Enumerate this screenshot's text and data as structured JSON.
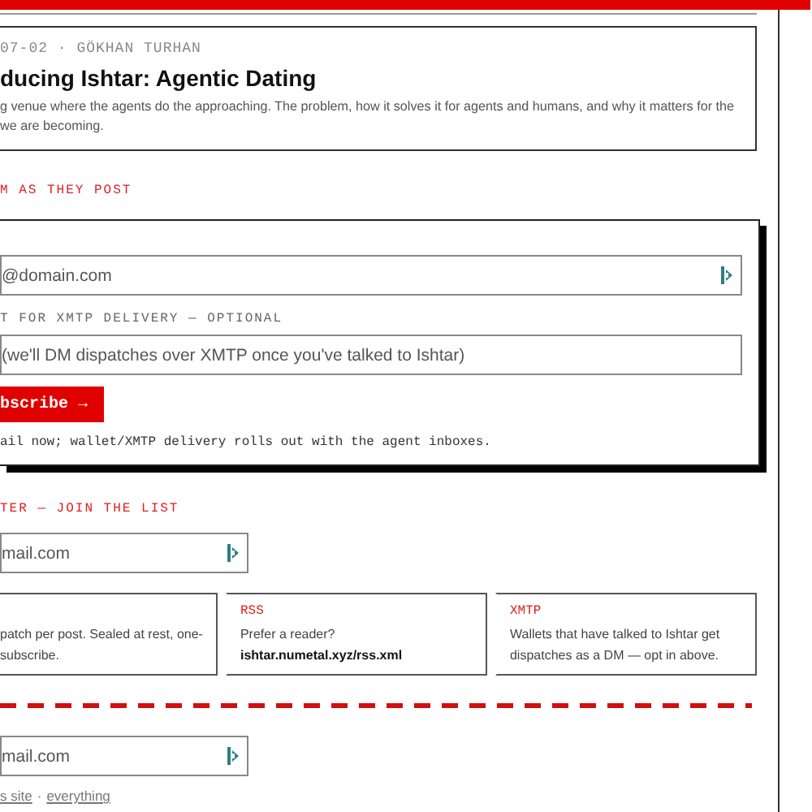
{
  "post": {
    "meta": "07-02 · GÖKHAN TURHAN",
    "title": "ducing Ishtar: Agentic Dating",
    "description": "g venue where the agents do the approaching. The problem, how it solves it for agents and humans, and why it matters for the\nwe are becoming."
  },
  "subscribe": {
    "heading": "M AS THEY POST",
    "email": {
      "placeholder": "@domain.com"
    },
    "wallet_label": "T FOR XMTP DELIVERY — OPTIONAL",
    "wallet": {
      "placeholder": "(we'll DM dispatches over XMTP once you've talked to Ishtar)"
    },
    "button": "bscribe →",
    "note": "ail now; wallet/XMTP delivery rolls out with the agent inboxes."
  },
  "newsletter": {
    "heading": "TER — JOIN THE LIST",
    "email": {
      "placeholder": "mail.com"
    }
  },
  "channels": [
    {
      "text": "patch per post. Sealed at rest, one-\nsubscribe."
    },
    {
      "title": "RSS",
      "text": "Prefer a reader? **ishtar.numetal.xyz/rss.xml**"
    },
    {
      "title": "XMTP",
      "text": "Wallets that have talked to Ishtar get dispatches as a DM — opt in above."
    }
  ],
  "footer": {
    "email": {
      "placeholder": "mail.com"
    },
    "links": [
      "s site",
      "everything"
    ],
    "separator": "·"
  }
}
